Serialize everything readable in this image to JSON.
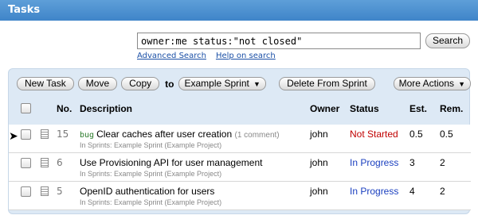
{
  "header": {
    "title": "Tasks"
  },
  "search": {
    "query": "owner:me status:\"not closed\"",
    "button_label": "Search",
    "advanced_link": "Advanced Search",
    "help_link": "Help on search"
  },
  "toolbar": {
    "new_task": "New Task",
    "move": "Move",
    "copy": "Copy",
    "to_label": "to",
    "sprint_select": "Example Sprint",
    "delete_from_sprint": "Delete From Sprint",
    "more_actions": "More Actions"
  },
  "table": {
    "headers": {
      "no": "No.",
      "description": "Description",
      "owner": "Owner",
      "status": "Status",
      "est": "Est.",
      "rem": "Rem."
    },
    "rows": [
      {
        "no": "15",
        "tag": "bug",
        "title": "Clear caches after user creation",
        "comments": "(1 comment)",
        "sprint": "In Sprints: Example Sprint (Example Project)",
        "owner": "john",
        "status": "Not Started",
        "status_color": "#c00000",
        "est": "0.5",
        "rem": "0.5"
      },
      {
        "no": "6",
        "tag": "",
        "title": "Use Provisioning API for user management",
        "comments": "",
        "sprint": "In Sprints: Example Sprint (Example Project)",
        "owner": "john",
        "status": "In Progress",
        "status_color": "#1a3fbf",
        "est": "3",
        "rem": "2"
      },
      {
        "no": "5",
        "tag": "",
        "title": "OpenID authentication for users",
        "comments": "",
        "sprint": "In Sprints: Example Sprint (Example Project)",
        "owner": "john",
        "status": "In Progress",
        "status_color": "#1a3fbf",
        "est": "4",
        "rem": "2"
      }
    ]
  },
  "colors": {
    "header_bg": "#4a8fd0",
    "panel_bg": "#dde9f5"
  }
}
